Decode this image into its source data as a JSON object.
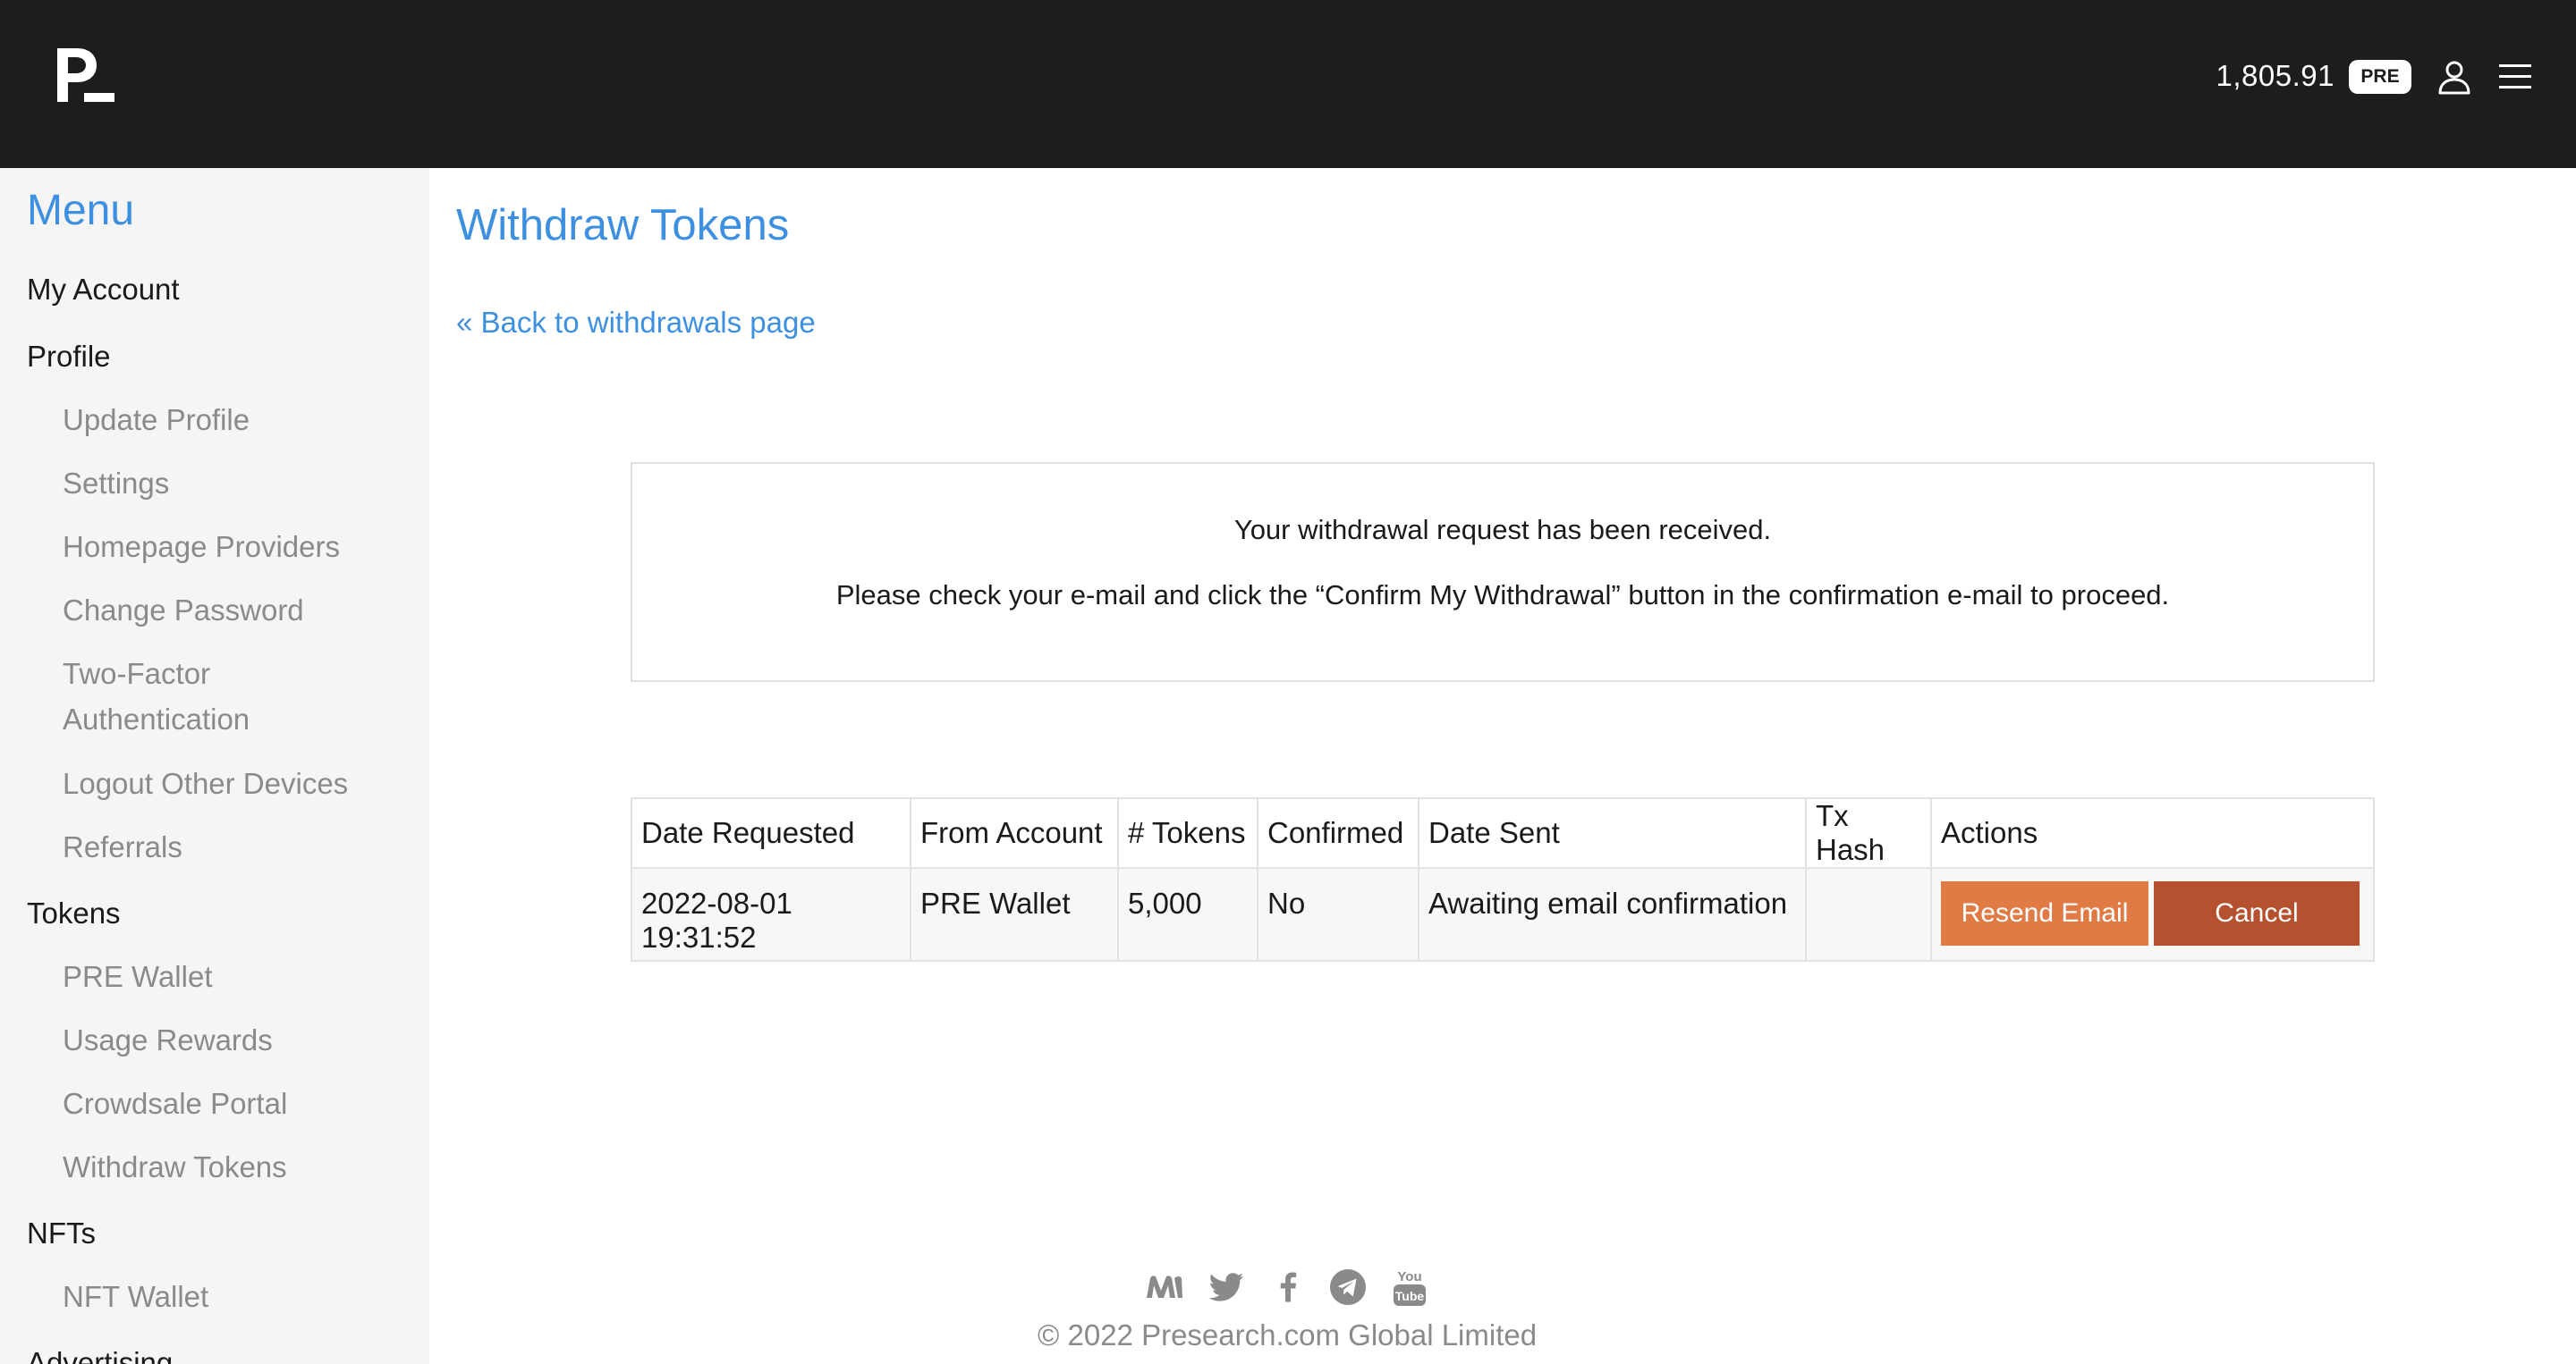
{
  "header": {
    "balance": "1,805.91",
    "badge": "PRE"
  },
  "sidebar": {
    "title": "Menu",
    "items": [
      {
        "label": "My Account",
        "type": "section"
      },
      {
        "label": "Profile",
        "type": "section"
      },
      {
        "label": "Update Profile",
        "type": "sub"
      },
      {
        "label": "Settings",
        "type": "sub"
      },
      {
        "label": "Homepage Providers",
        "type": "sub"
      },
      {
        "label": "Change Password",
        "type": "sub"
      },
      {
        "label": "Two-Factor",
        "type": "sub"
      },
      {
        "label": "Authentication",
        "type": "sub"
      },
      {
        "label": "Logout Other Devices",
        "type": "sub"
      },
      {
        "label": "Referrals",
        "type": "sub"
      },
      {
        "label": "Tokens",
        "type": "section"
      },
      {
        "label": "PRE Wallet",
        "type": "sub"
      },
      {
        "label": "Usage Rewards",
        "type": "sub"
      },
      {
        "label": "Crowdsale Portal",
        "type": "sub"
      },
      {
        "label": "Withdraw Tokens",
        "type": "sub"
      },
      {
        "label": "NFTs",
        "type": "section"
      },
      {
        "label": "NFT Wallet",
        "type": "sub"
      },
      {
        "label": "Advertising",
        "type": "section"
      }
    ]
  },
  "main": {
    "title": "Withdraw Tokens",
    "back_link": "« Back to withdrawals page",
    "notice": {
      "line1": "Your withdrawal request has been received.",
      "line2": "Please check your e-mail and click the “Confirm My Withdrawal” button in the confirmation e-mail to proceed."
    },
    "table": {
      "headers": [
        "Date Requested",
        "From Account",
        "# Tokens",
        "Confirmed",
        "Date Sent",
        "Tx Hash",
        "Actions"
      ],
      "rows": [
        [
          "2022-08-01 19:31:52",
          "PRE Wallet",
          "5,000",
          "No",
          "Awaiting email confirmation",
          ""
        ]
      ],
      "resend_label": "Resend Email",
      "cancel_label": "Cancel"
    }
  },
  "footer": {
    "social_icons": [
      "medium-icon",
      "twitter-icon",
      "facebook-icon",
      "telegram-icon",
      "youtube-icon"
    ],
    "youtube_text": "You Tube",
    "copyright": "© 2022 Presearch.com Global Limited"
  },
  "colors": {
    "accent": "#3d8fe0",
    "header_bg": "#1d1d1d",
    "resend": "#e07b45",
    "cancel": "#b5512f"
  }
}
